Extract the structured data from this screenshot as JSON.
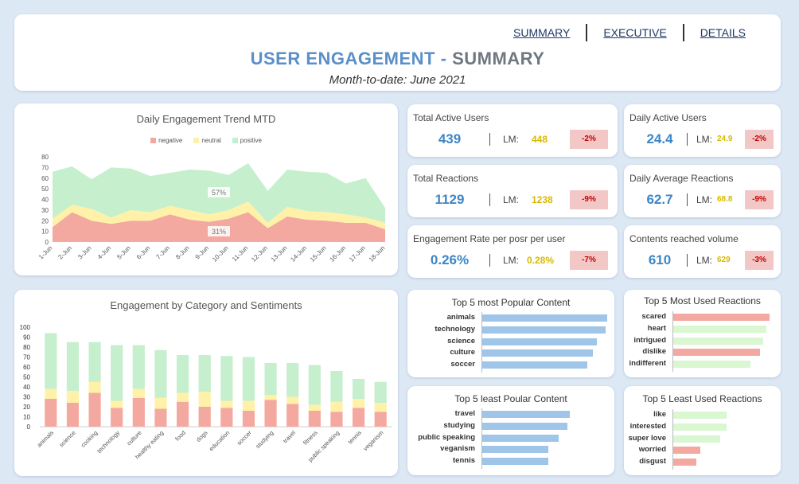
{
  "nav": {
    "summary": "SUMMARY",
    "executive": "EXECUTIVE",
    "details": "DETAILS"
  },
  "header": {
    "title_part1": "USER ENGAGEMENT",
    "title_dash": " - ",
    "title_part2": "SUMMARY",
    "subtitle": "Month-to-date: June 2021"
  },
  "kpis": [
    {
      "label": "Total Active Users",
      "value": "439",
      "lm_label": "LM:",
      "lm_value": "448",
      "change": "-2%"
    },
    {
      "label": "Daily Active Users",
      "value": "24.4",
      "lm_label": "LM:",
      "lm_value": "24.9",
      "change": "-2%"
    },
    {
      "label": "Total Reactions",
      "value": "1129",
      "lm_label": "LM:",
      "lm_value": "1238",
      "change": "-9%"
    },
    {
      "label": "Daily Average Reactions",
      "value": "62.7",
      "lm_label": "LM:",
      "lm_value": "68.8",
      "change": "-9%"
    },
    {
      "label": "Engagement Rate per posr per user",
      "value": "0.26%",
      "lm_label": "LM:",
      "lm_value": "0.28%",
      "change": "-7%"
    },
    {
      "label": "Contents reached volume",
      "value": "610",
      "lm_label": "LM:",
      "lm_value": "629",
      "change": "-3%"
    }
  ],
  "colors": {
    "negative": "#f4a9a0",
    "neutral": "#fff2a8",
    "positive": "#c6efce",
    "bar_blue": "#9fc5e8",
    "bar_red": "#f4a9a0",
    "bar_green": "#d9f7d0",
    "badge_bg": "#f4c7c7",
    "badge_text": "#c00000",
    "value_blue": "#3d85c6",
    "lm_yellow": "#d9b800"
  },
  "chart_data": [
    {
      "type": "area",
      "title": "Daily Engagement Trend MTD",
      "legend": [
        "negative",
        "neutral",
        "positive"
      ],
      "legend_position": "top",
      "x": [
        "1-Jun",
        "2-Jun",
        "3-Jun",
        "4-Jun",
        "5-Jun",
        "6-Jun",
        "7-Jun",
        "8-Jun",
        "9-Jun",
        "10-Jun",
        "11-Jun",
        "12-Jun",
        "13-Jun",
        "14-Jun",
        "15-Jun",
        "16-Jun",
        "17-Jun",
        "18-Jun"
      ],
      "stacked": true,
      "series": [
        {
          "name": "negative",
          "values": [
            14,
            28,
            20,
            17,
            20,
            20,
            26,
            21,
            19,
            22,
            28,
            13,
            24,
            21,
            20,
            18,
            18,
            12
          ]
        },
        {
          "name": "neutral",
          "values": [
            8,
            7,
            11,
            6,
            10,
            8,
            8,
            9,
            7,
            8,
            10,
            5,
            9,
            8,
            8,
            8,
            5,
            6
          ]
        },
        {
          "name": "positive",
          "values": [
            44,
            36,
            28,
            47,
            39,
            34,
            31,
            38,
            41,
            33,
            36,
            30,
            35,
            37,
            37,
            29,
            37,
            14
          ]
        }
      ],
      "annotations": [
        "57%",
        "31%"
      ],
      "ylim": [
        0,
        80
      ],
      "yticks": [
        0,
        10,
        20,
        30,
        40,
        50,
        60,
        70,
        80
      ]
    },
    {
      "type": "bar",
      "title": "Engagement by Category and Sentiments",
      "stacked": true,
      "categories": [
        "animals",
        "science",
        "cooking",
        "technology",
        "culture",
        "healthy eating",
        "food",
        "dogs",
        "education",
        "soccer",
        "studying",
        "travel",
        "fitness",
        "public speaking",
        "tennis",
        "veganism"
      ],
      "series": [
        {
          "name": "negative",
          "values": [
            28,
            24,
            34,
            19,
            29,
            18,
            25,
            20,
            19,
            16,
            27,
            23,
            16,
            15,
            19,
            15
          ]
        },
        {
          "name": "neutral",
          "values": [
            10,
            12,
            11,
            7,
            9,
            11,
            9,
            15,
            7,
            10,
            5,
            7,
            6,
            10,
            9,
            9
          ]
        },
        {
          "name": "positive",
          "values": [
            56,
            49,
            40,
            56,
            44,
            48,
            38,
            37,
            45,
            44,
            32,
            34,
            40,
            31,
            20,
            21
          ]
        }
      ],
      "ylim": [
        0,
        100
      ],
      "yticks": [
        0,
        10,
        20,
        30,
        40,
        50,
        60,
        70,
        80,
        90,
        100
      ]
    },
    {
      "type": "bar",
      "orientation": "horizontal",
      "title": "Top 5 most Popular Content",
      "categories": [
        "animals",
        "technology",
        "science",
        "culture",
        "soccer"
      ],
      "values": [
        94,
        93,
        86,
        83,
        79
      ]
    },
    {
      "type": "bar",
      "orientation": "horizontal",
      "title": "Top 5 least Poular Content",
      "categories": [
        "travel",
        "studying",
        "public speaking",
        "veganism",
        "tennis"
      ],
      "values": [
        64,
        62,
        56,
        48,
        48
      ]
    },
    {
      "type": "bar",
      "orientation": "horizontal",
      "title": "Top 5 Most Used Reactions",
      "categories": [
        "scared",
        "heart",
        "intrigued",
        "dislike",
        "indifferent"
      ],
      "values": [
        120,
        116,
        112,
        108,
        96
      ],
      "bar_colors": [
        "red",
        "green",
        "green",
        "red",
        "green"
      ]
    },
    {
      "type": "bar",
      "orientation": "horizontal",
      "title": "Top 5 Least Used Reactions",
      "categories": [
        "like",
        "interested",
        "super love",
        "worried",
        "disgust"
      ],
      "values": [
        66,
        66,
        58,
        33,
        29
      ],
      "bar_colors": [
        "green",
        "green",
        "green",
        "red",
        "red"
      ]
    }
  ]
}
